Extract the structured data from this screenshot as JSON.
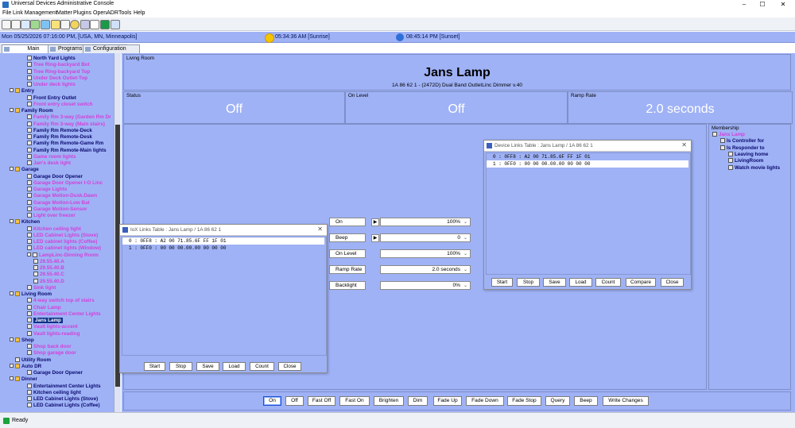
{
  "window": {
    "title": "Universal Devices Administrative Console",
    "controls": [
      "–",
      "☐",
      "✕"
    ]
  },
  "menu": [
    "File",
    "Link Management",
    "Matter",
    "Plugins",
    "OpenADR",
    "Tools",
    "Help"
  ],
  "timebar": {
    "datetime": "Mon 05/25/2026 07:16:00 PM,  [USA, MN, Minneapolis]",
    "sunrise": "05:34:36 AM [Sunrise]",
    "sunset": "08:45:14 PM [Sunset]"
  },
  "tabs": [
    "Main",
    "Programs",
    "Configuration"
  ],
  "tree": [
    {
      "label": "North Yard Lights",
      "level": 2,
      "color": "dark"
    },
    {
      "label": "Tree Ring-backyard Bot",
      "level": 2,
      "color": "pink"
    },
    {
      "label": "Tree Ring-backyard Top",
      "level": 2,
      "color": "pink"
    },
    {
      "label": "Under Deck Outlet-Top",
      "level": 2,
      "color": "pink"
    },
    {
      "label": "Under deck lights",
      "level": 2,
      "color": "pink"
    },
    {
      "label": "Entry",
      "level": 1,
      "color": "dark",
      "folder": true
    },
    {
      "label": "Front Entry Outlet",
      "level": 2,
      "color": "dark"
    },
    {
      "label": "Front entry closet switch",
      "level": 2,
      "color": "pink"
    },
    {
      "label": "Family Room",
      "level": 1,
      "color": "dark",
      "folder": true
    },
    {
      "label": "Family Rm 3-way (Garden Rm Dr",
      "level": 2,
      "color": "pink"
    },
    {
      "label": "Family Rm 3-way (Main stairs)",
      "level": 2,
      "color": "pink"
    },
    {
      "label": "Family Rm Remote-Deck",
      "level": 2,
      "color": "dark"
    },
    {
      "label": "Family Rm Remote-Desk",
      "level": 2,
      "color": "dark"
    },
    {
      "label": "Family Rm Remote-Game Rm",
      "level": 2,
      "color": "dark"
    },
    {
      "label": "Family Rm Remote-Main lights",
      "level": 2,
      "color": "dark"
    },
    {
      "label": "Game room lights",
      "level": 2,
      "color": "pink"
    },
    {
      "label": "Jan's desk light",
      "level": 2,
      "color": "pink"
    },
    {
      "label": "Garage",
      "level": 1,
      "color": "dark",
      "folder": true
    },
    {
      "label": "Garage Door Opener",
      "level": 2,
      "color": "dark"
    },
    {
      "label": "Garage Door Opener I-O Linc",
      "level": 2,
      "color": "pink"
    },
    {
      "label": "Garage Lights",
      "level": 2,
      "color": "pink"
    },
    {
      "label": "Garage Motion-Dusk.Dawn",
      "level": 2,
      "color": "pink"
    },
    {
      "label": "Garage Motion-Low Bat",
      "level": 2,
      "color": "pink"
    },
    {
      "label": "Garage Motion-Sensor",
      "level": 2,
      "color": "pink"
    },
    {
      "label": "Light over freezer",
      "level": 2,
      "color": "pink"
    },
    {
      "label": "Kitchen",
      "level": 1,
      "color": "dark",
      "folder": true
    },
    {
      "label": "Kitchen ceiling light",
      "level": 2,
      "color": "pink"
    },
    {
      "label": "LED Cabinet Lights (Stove)",
      "level": 2,
      "color": "pink"
    },
    {
      "label": "LED cabinet lights (Coffee)",
      "level": 2,
      "color": "pink"
    },
    {
      "label": "LED cabinet lights (Window)",
      "level": 2,
      "color": "pink"
    },
    {
      "label": "LampLinc-Dinning Room",
      "level": 2,
      "color": "pink",
      "expander": true
    },
    {
      "label": "29.55.40.A",
      "level": 3,
      "color": "pink"
    },
    {
      "label": "29.55.40.B",
      "level": 3,
      "color": "pink"
    },
    {
      "label": "29.55.40.C",
      "level": 3,
      "color": "pink"
    },
    {
      "label": "29.55.40.D",
      "level": 3,
      "color": "pink"
    },
    {
      "label": "Sink light",
      "level": 2,
      "color": "pink"
    },
    {
      "label": "Living Room",
      "level": 1,
      "color": "dark",
      "folder": true
    },
    {
      "label": "4-way switch top of stairs",
      "level": 2,
      "color": "pink"
    },
    {
      "label": "Chair Lamp",
      "level": 2,
      "color": "pink"
    },
    {
      "label": "Entertainment Center Lights",
      "level": 2,
      "color": "pink"
    },
    {
      "label": "Jans Lamp",
      "level": 2,
      "color": "selected"
    },
    {
      "label": "Vault lights-accent",
      "level": 2,
      "color": "pink"
    },
    {
      "label": "Vault lights-reading",
      "level": 2,
      "color": "pink"
    },
    {
      "label": "Shop",
      "level": 1,
      "color": "dark",
      "folder": true
    },
    {
      "label": "Shop back door",
      "level": 2,
      "color": "pink"
    },
    {
      "label": "Shop garage door",
      "level": 2,
      "color": "pink"
    },
    {
      "label": "Utility Room",
      "level": 1,
      "color": "dark",
      "noexp": true
    },
    {
      "label": "Auto DR",
      "level": 1,
      "color": "dark",
      "folder": true
    },
    {
      "label": "Garage Door Opener",
      "level": 2,
      "color": "dark"
    },
    {
      "label": "Dinner",
      "level": 1,
      "color": "dark",
      "folder": true
    },
    {
      "label": "Entertainment Center Lights",
      "level": 2,
      "color": "dark"
    },
    {
      "label": "Kitchen ceiling light",
      "level": 2,
      "color": "dark"
    },
    {
      "label": "LED Cabinet Lights (Stove)",
      "level": 2,
      "color": "dark"
    },
    {
      "label": "LED Cabinet Lights (Coffee)",
      "level": 2,
      "color": "dark"
    }
  ],
  "device": {
    "room": "Living Room",
    "name": "Jans Lamp",
    "subtitle": "1A 86 62 1 - (2472D) Dual Band OutletLinc Dimmer v.40"
  },
  "values": [
    {
      "label": "Status",
      "value": "Off"
    },
    {
      "label": "On Level",
      "value": "Off"
    },
    {
      "label": "Ramp Rate",
      "value": "2.0 seconds"
    }
  ],
  "properties": [
    {
      "label": "On",
      "value": "100%",
      "arrow": true
    },
    {
      "label": "Beep",
      "value": "0",
      "arrow": true
    },
    {
      "label": "On Level",
      "value": "100%",
      "arrow": false
    },
    {
      "label": "Ramp Rate",
      "value": "2.0 seconds",
      "arrow": false
    },
    {
      "label": "Backlight",
      "value": "0%",
      "arrow": false
    }
  ],
  "membership": {
    "title": "Membership",
    "items": [
      {
        "label": "Jans Lamp",
        "indent": 0,
        "color": "pink"
      },
      {
        "label": "Is Controller for",
        "indent": 1,
        "color": "dark"
      },
      {
        "label": "Is Responder to",
        "indent": 1,
        "color": "dark"
      },
      {
        "label": "Leaving home",
        "indent": 2,
        "color": "dark"
      },
      {
        "label": "LivingRoom",
        "indent": 2,
        "color": "dark"
      },
      {
        "label": "Watch movie lights",
        "indent": 2,
        "color": "dark"
      }
    ]
  },
  "commands": [
    "On",
    "Off",
    "Fast Off",
    "Fast On",
    "Brighten",
    "Dim",
    "Fade Up",
    "Fade Down",
    "Fade Stop",
    "Query",
    "Beep",
    "Write Changes"
  ],
  "iox_dialog": {
    "title": "IoX Links Table : Jans Lamp / 1A 86 62 1",
    "rows": [
      "0 : 0FF8 : A2 00 71.85.6F FF 1F 01",
      "1 : 0FF0 : 00 00 00.00.00 00 00 00"
    ],
    "buttons": [
      "Start",
      "Stop",
      "Save",
      "Load",
      "Count",
      "Close"
    ]
  },
  "device_dialog": {
    "title": "Device Links Table : Jans Lamp / 1A 86 62 1",
    "rows": [
      "0 : 0FF8 : A2 00 71.85.6F FF 1F 01",
      "1 : 0FF0 : 00 00 00.00.00 00 00 00"
    ],
    "buttons": [
      "Start",
      "Stop",
      "Save",
      "Load",
      "Count",
      "Compare",
      "Close"
    ]
  },
  "statusbar": {
    "text": "Ready"
  },
  "colors": {
    "panel": "#9fb2f6",
    "pink_node": "#d43fd9",
    "dark_node": "#0a0a6e",
    "value_text": "#ffffff"
  }
}
